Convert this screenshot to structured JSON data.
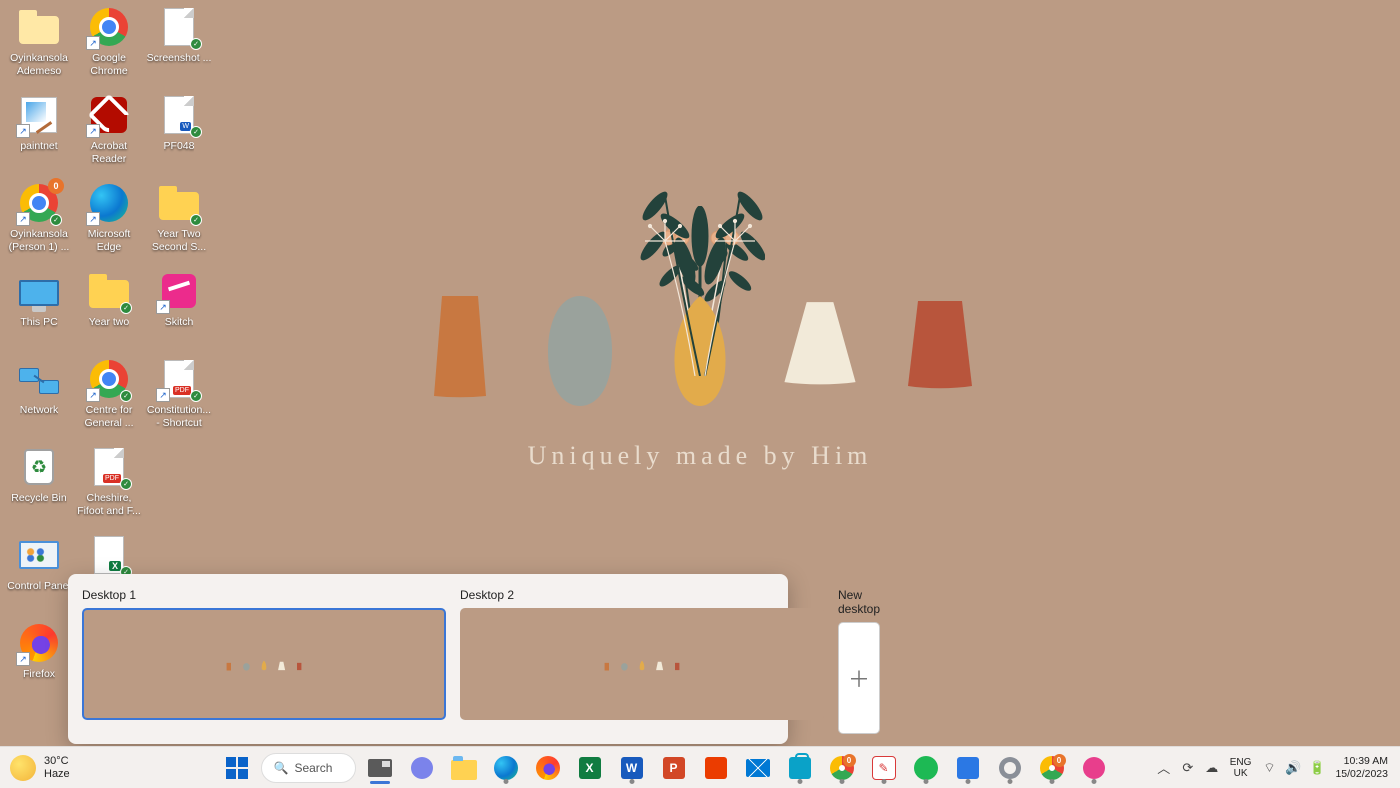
{
  "wallpaper": {
    "tagline": "Uniquely made by Him"
  },
  "desktop_icons": {
    "col1": [
      {
        "key": "user-folder",
        "label": "Oyinkansola Ademeso"
      },
      {
        "key": "paintnet",
        "label": "paintnet"
      },
      {
        "key": "chrome-profile",
        "label": "Oyinkansola (Person 1) ...",
        "badge": "0"
      },
      {
        "key": "this-pc",
        "label": "This PC"
      },
      {
        "key": "network",
        "label": "Network"
      },
      {
        "key": "recycle-bin",
        "label": "Recycle Bin"
      },
      {
        "key": "control-panel",
        "label": "Control Panel"
      },
      {
        "key": "firefox",
        "label": "Firefox"
      }
    ],
    "col2": [
      {
        "key": "google-chrome",
        "label": "Google Chrome"
      },
      {
        "key": "acrobat-reader",
        "label": "Acrobat Reader"
      },
      {
        "key": "microsoft-edge",
        "label": "Microsoft Edge"
      },
      {
        "key": "year-two",
        "label": "Year two"
      },
      {
        "key": "centre-for-general",
        "label": "Centre for General ..."
      },
      {
        "key": "cheshire",
        "label": "Cheshire, Fifoot and F..."
      },
      {
        "key": "excel-file",
        "label": ""
      }
    ],
    "col3": [
      {
        "key": "screenshot",
        "label": "Screenshot ..."
      },
      {
        "key": "pf048",
        "label": "PF048"
      },
      {
        "key": "year-two-second",
        "label": "Year Two Second S..."
      },
      {
        "key": "skitch",
        "label": "Skitch"
      },
      {
        "key": "constitution",
        "label": "Constitution... - Shortcut"
      }
    ]
  },
  "task_view": {
    "desktops": [
      {
        "label": "Desktop 1",
        "active": true
      },
      {
        "label": "Desktop 2",
        "active": false
      }
    ],
    "new_label": "New desktop"
  },
  "taskbar": {
    "weather": {
      "temp": "30°C",
      "cond": "Haze"
    },
    "search_label": "Search",
    "apps": [
      {
        "key": "start",
        "name": "start-button"
      },
      {
        "key": "search",
        "name": "search"
      },
      {
        "key": "taskview",
        "name": "task-view",
        "active": true
      },
      {
        "key": "chat",
        "name": "chat"
      },
      {
        "key": "explorer",
        "name": "file-explorer"
      },
      {
        "key": "edge",
        "name": "edge",
        "running": true
      },
      {
        "key": "firefox",
        "name": "firefox"
      },
      {
        "key": "excel",
        "name": "excel"
      },
      {
        "key": "word",
        "name": "word",
        "running": true
      },
      {
        "key": "powerpoint",
        "name": "powerpoint"
      },
      {
        "key": "office",
        "name": "office"
      },
      {
        "key": "mail",
        "name": "mail"
      },
      {
        "key": "store",
        "name": "microsoft-store",
        "running": true
      },
      {
        "key": "chrome",
        "name": "chrome",
        "count": "0",
        "running": true
      },
      {
        "key": "snip",
        "name": "snip-sketch",
        "running": true
      },
      {
        "key": "spotify",
        "name": "spotify",
        "running": true
      },
      {
        "key": "phonelink",
        "name": "phone-link",
        "running": true
      },
      {
        "key": "settings",
        "name": "settings",
        "running": true
      },
      {
        "key": "chrome2",
        "name": "chrome-profile2",
        "count": "0",
        "running": true
      },
      {
        "key": "pink",
        "name": "pink-app",
        "running": true
      }
    ],
    "tray": {
      "lang_top": "ENG",
      "lang_bottom": "UK",
      "time": "10:39 AM",
      "date": "15/02/2023"
    }
  }
}
